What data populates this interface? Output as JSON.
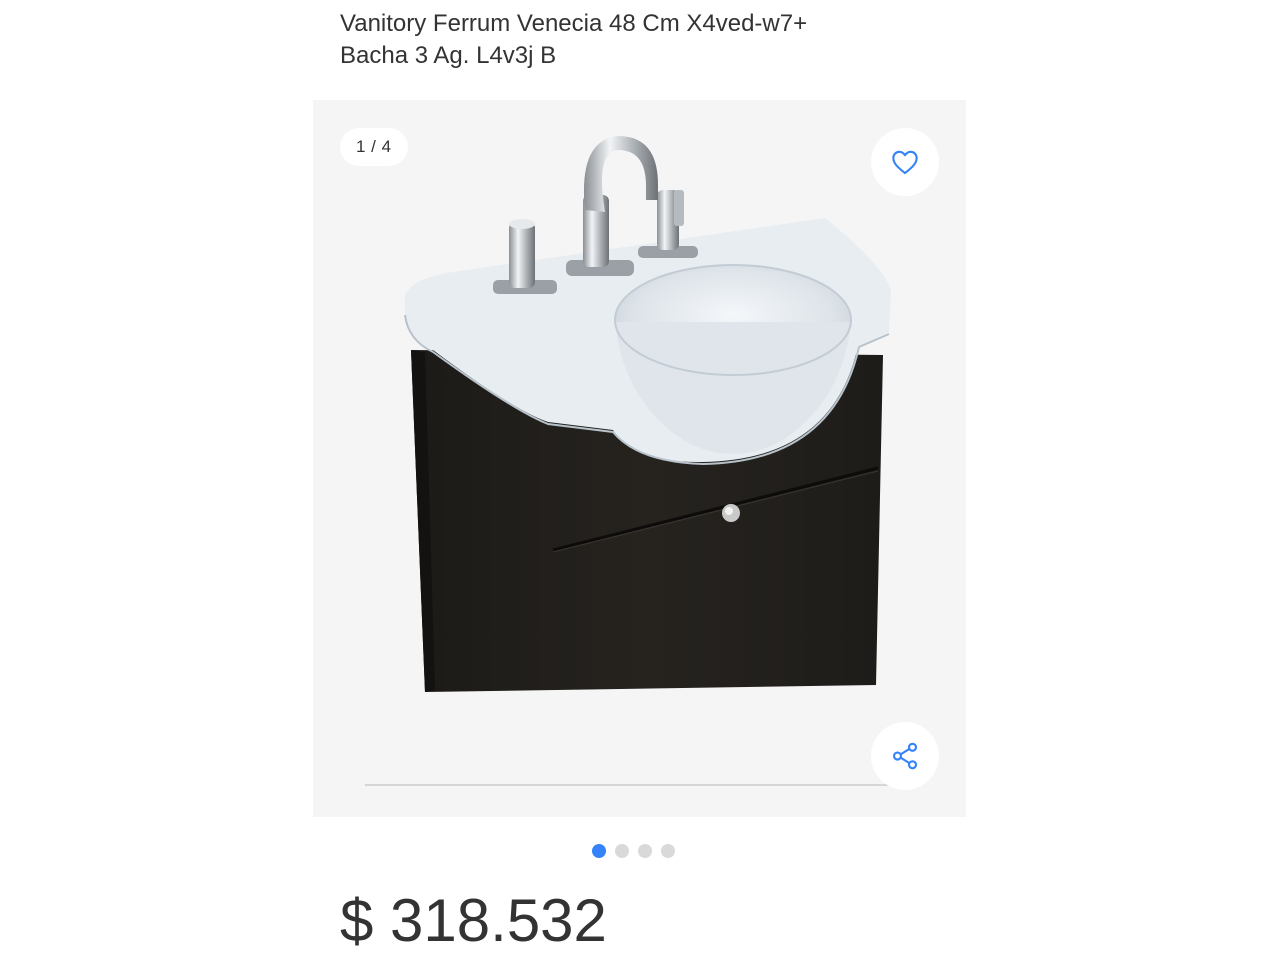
{
  "product": {
    "title_line1": "Vanitory Ferrum Venecia 48 Cm X4ved-w7+",
    "title_line2": "Bacha 3 Ag. L4v3j B",
    "price": "$ 318.532"
  },
  "gallery": {
    "counter": "1 / 4",
    "current_image": 1,
    "total_images": 4,
    "icons": {
      "favorite": "heart-icon",
      "share": "share-icon"
    },
    "accent_color": "#3483fa"
  }
}
